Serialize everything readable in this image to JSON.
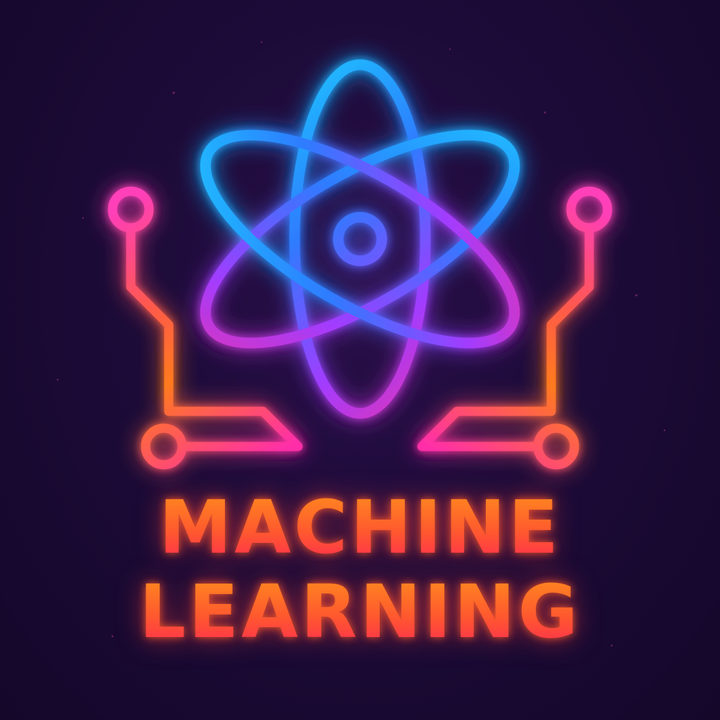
{
  "title": {
    "line1": "MACHINE",
    "line2": "LEARNING"
  },
  "icons": {
    "main": "atom-icon",
    "decoration": "circuit-trace-icon"
  },
  "colors": {
    "background": "#1c0b38",
    "atom_cyan": "#19c8ff",
    "atom_blue": "#2f7bff",
    "atom_violet": "#a23cff",
    "atom_magenta": "#ff2fa8",
    "circuit_orange": "#ff7a1e",
    "circuit_pink": "#ff2fb0",
    "text_orange": "#ff7a1e",
    "text_red": "#ff2e4f"
  }
}
